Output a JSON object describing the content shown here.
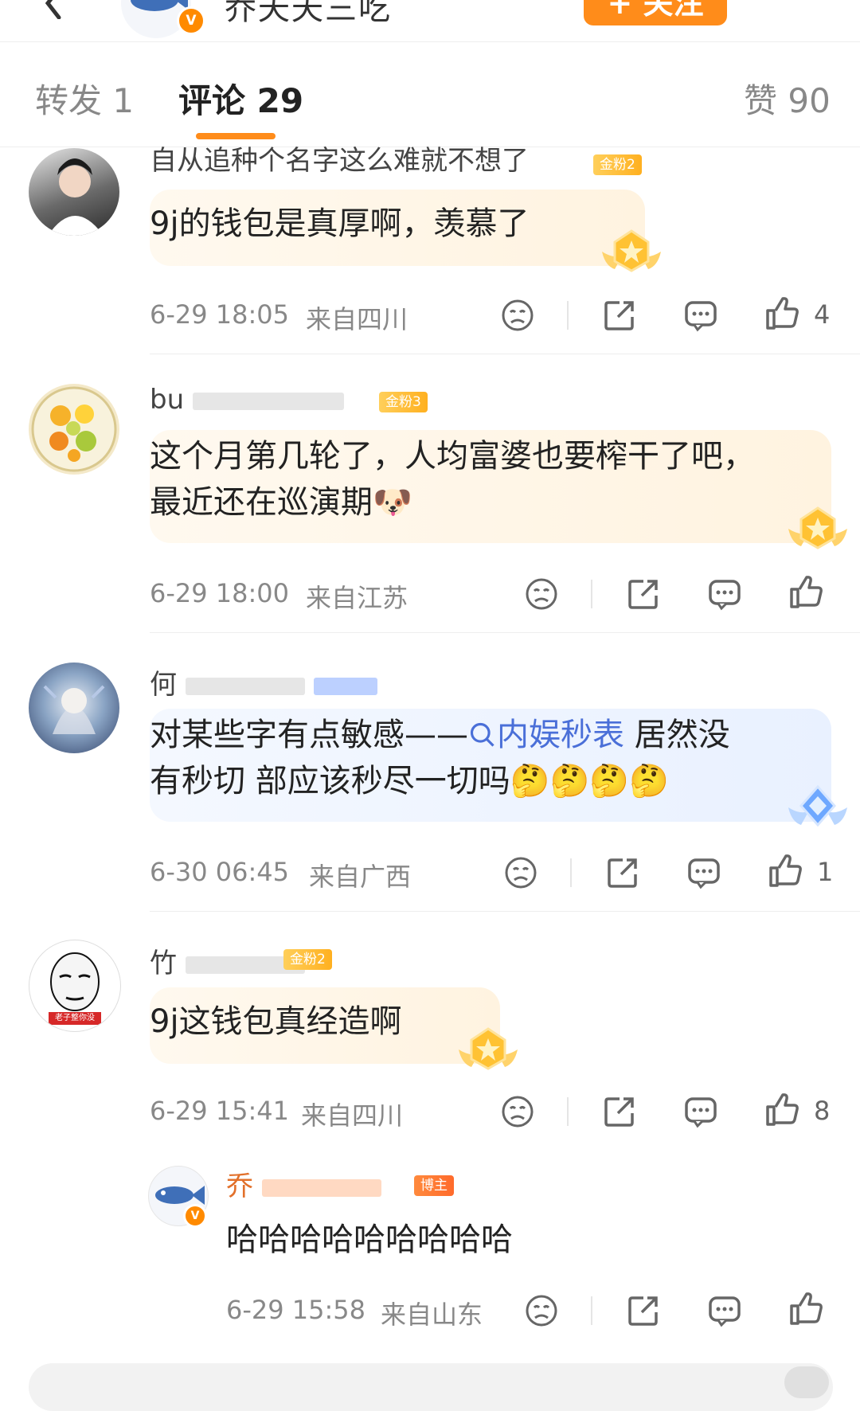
{
  "header": {
    "name": "乔夭夭三吃",
    "follow_label": "+ 关注",
    "verified_mark": "V"
  },
  "tabs": {
    "repost": "转发 1",
    "comments": "评论 29",
    "likes": "赞 90"
  },
  "comments": [
    {
      "username": "自从追种个名字这么难就不想了",
      "badge": "金粉2",
      "text": "9j的钱包是真厚啊，羡慕了",
      "date": "6-29 18:05",
      "location": "来自四川",
      "likes": "4"
    },
    {
      "username": "bu",
      "badge": "金粉3",
      "text_line1": "这个月第几轮了，人均富婆也要榨干了吧，",
      "text_line2": "最近还在巡演期",
      "emoji": "🐶",
      "date": "6-29 18:00",
      "location": "来自江苏",
      "likes": ""
    },
    {
      "username": "何",
      "text_pre": "对某些字有点敏感——",
      "link_text": "内娱秒表",
      "text_post": " 居然没",
      "text_line2": "有秒切 部应该秒尽一切吗",
      "emojis": "🤔🤔🤔🤔",
      "date": "6-30 06:45",
      "location": "来自广西",
      "likes": "1"
    },
    {
      "username": "竹",
      "badge": "金粉2",
      "avatar_caption": "老子整你没",
      "text": "9j这钱包真经造啊",
      "date": "6-29 15:41",
      "location": "来自四川",
      "likes": "8"
    }
  ],
  "reply": {
    "username": "乔",
    "badge": "博主",
    "text": "哈哈哈哈哈哈哈哈哈",
    "date": "6-29 15:58",
    "location": "来自山东",
    "likes": ""
  },
  "colors": {
    "accent": "#ff8c1a",
    "link": "#4a6fd8",
    "meta": "#888888"
  },
  "icons": [
    "back-arrow-icon",
    "dislike-face-icon",
    "share-icon",
    "comment-icon",
    "thumb-up-icon",
    "search-icon",
    "medal-icon",
    "fish-avatar-icon"
  ]
}
